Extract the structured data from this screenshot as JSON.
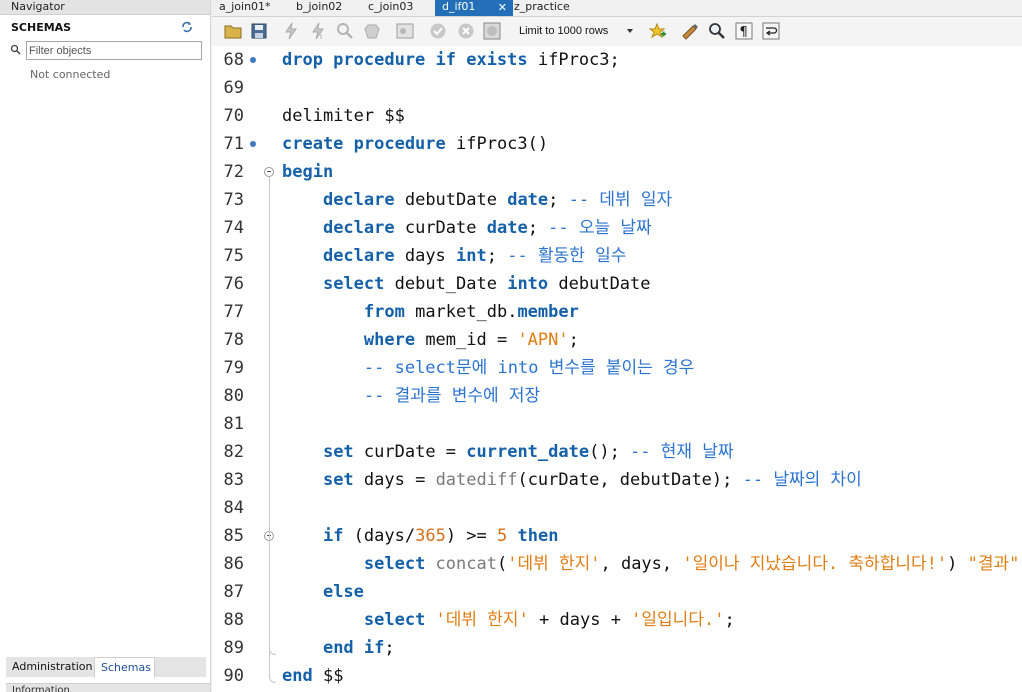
{
  "navigator": {
    "header": "Navigator",
    "schemas_title": "SCHEMAS",
    "filter_placeholder": "Filter objects",
    "status": "Not connected",
    "bottom_tabs": [
      "Administration",
      "Schemas"
    ],
    "info_label": "Information"
  },
  "tabs": [
    {
      "label": "a_join01*",
      "active": false
    },
    {
      "label": "b_join02",
      "active": false
    },
    {
      "label": "c_join03",
      "active": false
    },
    {
      "label": "d_if01",
      "active": true
    },
    {
      "label": "z_practice",
      "active": false
    }
  ],
  "toolbar": {
    "limit_label": "Limit to 1000 rows",
    "icons": [
      "open-file-icon",
      "save-icon",
      "execute-icon",
      "execute-current-icon",
      "explain-icon",
      "stop-icon",
      "toggle-results-icon",
      "commit-icon",
      "rollback-icon",
      "autocommit-icon",
      "add-snippet-icon",
      "beautify-icon",
      "find-icon",
      "invisible-chars-icon",
      "wrap-icon"
    ]
  },
  "editor": {
    "lines": [
      {
        "n": "68",
        "marker": true,
        "tokens": [
          [
            "kw",
            "drop procedure if exists "
          ],
          [
            "id",
            "ifProc3;"
          ]
        ]
      },
      {
        "n": "69",
        "marker": false,
        "tokens": []
      },
      {
        "n": "70",
        "marker": false,
        "tokens": [
          [
            "id",
            "delimiter $$"
          ]
        ]
      },
      {
        "n": "71",
        "marker": true,
        "tokens": [
          [
            "kw",
            "create procedure "
          ],
          [
            "id",
            "ifProc3()"
          ]
        ]
      },
      {
        "n": "72",
        "marker": false,
        "fold": true,
        "tokens": [
          [
            "kw",
            "begin"
          ]
        ]
      },
      {
        "n": "73",
        "marker": false,
        "tokens": [
          [
            "id",
            "    "
          ],
          [
            "kw",
            "declare "
          ],
          [
            "id",
            "debutDate "
          ],
          [
            "kw",
            "date"
          ],
          [
            "id",
            "; "
          ],
          [
            "cmt",
            "-- 데뷔 일자"
          ]
        ]
      },
      {
        "n": "74",
        "marker": false,
        "tokens": [
          [
            "id",
            "    "
          ],
          [
            "kw",
            "declare "
          ],
          [
            "id",
            "curDate "
          ],
          [
            "kw",
            "date"
          ],
          [
            "id",
            "; "
          ],
          [
            "cmt",
            "-- 오늘 날짜"
          ]
        ]
      },
      {
        "n": "75",
        "marker": false,
        "tokens": [
          [
            "id",
            "    "
          ],
          [
            "kw",
            "declare "
          ],
          [
            "id",
            "days "
          ],
          [
            "kw",
            "int"
          ],
          [
            "id",
            "; "
          ],
          [
            "cmt",
            "-- 활동한 일수"
          ]
        ]
      },
      {
        "n": "76",
        "marker": false,
        "tokens": [
          [
            "id",
            "    "
          ],
          [
            "kw",
            "select "
          ],
          [
            "id",
            "debut_Date "
          ],
          [
            "kw",
            "into "
          ],
          [
            "id",
            "debutDate"
          ]
        ]
      },
      {
        "n": "77",
        "marker": false,
        "tokens": [
          [
            "id",
            "        "
          ],
          [
            "kw",
            "from "
          ],
          [
            "id",
            "market_db."
          ],
          [
            "kw",
            "member"
          ]
        ]
      },
      {
        "n": "78",
        "marker": false,
        "tokens": [
          [
            "id",
            "        "
          ],
          [
            "kw",
            "where "
          ],
          [
            "id",
            "mem_id = "
          ],
          [
            "str",
            "'APN'"
          ],
          [
            "id",
            ";"
          ]
        ]
      },
      {
        "n": "79",
        "marker": false,
        "tokens": [
          [
            "id",
            "        "
          ],
          [
            "cmt",
            "-- select문에 into 변수를 붙이는 경우"
          ]
        ]
      },
      {
        "n": "80",
        "marker": false,
        "tokens": [
          [
            "id",
            "        "
          ],
          [
            "cmt",
            "-- 결과를 변수에 저장"
          ]
        ]
      },
      {
        "n": "81",
        "marker": false,
        "tokens": []
      },
      {
        "n": "82",
        "marker": false,
        "tokens": [
          [
            "id",
            "    "
          ],
          [
            "kw",
            "set "
          ],
          [
            "id",
            "curDate = "
          ],
          [
            "kw",
            "current_date"
          ],
          [
            "id",
            "(); "
          ],
          [
            "cmt",
            "-- 현재 날짜"
          ]
        ]
      },
      {
        "n": "83",
        "marker": false,
        "tokens": [
          [
            "id",
            "    "
          ],
          [
            "kw",
            "set "
          ],
          [
            "id",
            "days = "
          ],
          [
            "fn",
            "datediff"
          ],
          [
            "id",
            "(curDate, debutDate); "
          ],
          [
            "cmt",
            "-- 날짜의 차이"
          ]
        ]
      },
      {
        "n": "84",
        "marker": false,
        "tokens": []
      },
      {
        "n": "85",
        "marker": false,
        "fold": true,
        "tokens": [
          [
            "id",
            "    "
          ],
          [
            "kw",
            "if "
          ],
          [
            "id",
            "(days/"
          ],
          [
            "num",
            "365"
          ],
          [
            "id",
            ") >= "
          ],
          [
            "num",
            "5 "
          ],
          [
            "kw",
            "then"
          ]
        ]
      },
      {
        "n": "86",
        "marker": false,
        "tokens": [
          [
            "id",
            "        "
          ],
          [
            "kw",
            "select "
          ],
          [
            "fn",
            "concat"
          ],
          [
            "id",
            "("
          ],
          [
            "str",
            "'데뷔 한지'"
          ],
          [
            "id",
            ", days, "
          ],
          [
            "str",
            "'일이나 지났습니다. 축하합니다!'"
          ],
          [
            "id",
            ") "
          ],
          [
            "str",
            "\"결과\""
          ],
          [
            "id",
            ";"
          ]
        ]
      },
      {
        "n": "87",
        "marker": false,
        "tokens": [
          [
            "id",
            "    "
          ],
          [
            "kw",
            "else"
          ]
        ]
      },
      {
        "n": "88",
        "marker": false,
        "tokens": [
          [
            "id",
            "        "
          ],
          [
            "kw",
            "select "
          ],
          [
            "str",
            "'데뷔 한지'"
          ],
          [
            "id",
            " + days + "
          ],
          [
            "str",
            "'일입니다.'"
          ],
          [
            "id",
            ";"
          ]
        ]
      },
      {
        "n": "89",
        "marker": false,
        "foldend": true,
        "tokens": [
          [
            "id",
            "    "
          ],
          [
            "kw",
            "end if"
          ],
          [
            "id",
            ";"
          ]
        ]
      },
      {
        "n": "90",
        "marker": false,
        "foldend": true,
        "tokens": [
          [
            "kw",
            "end "
          ],
          [
            "id",
            "$$"
          ]
        ]
      }
    ]
  }
}
